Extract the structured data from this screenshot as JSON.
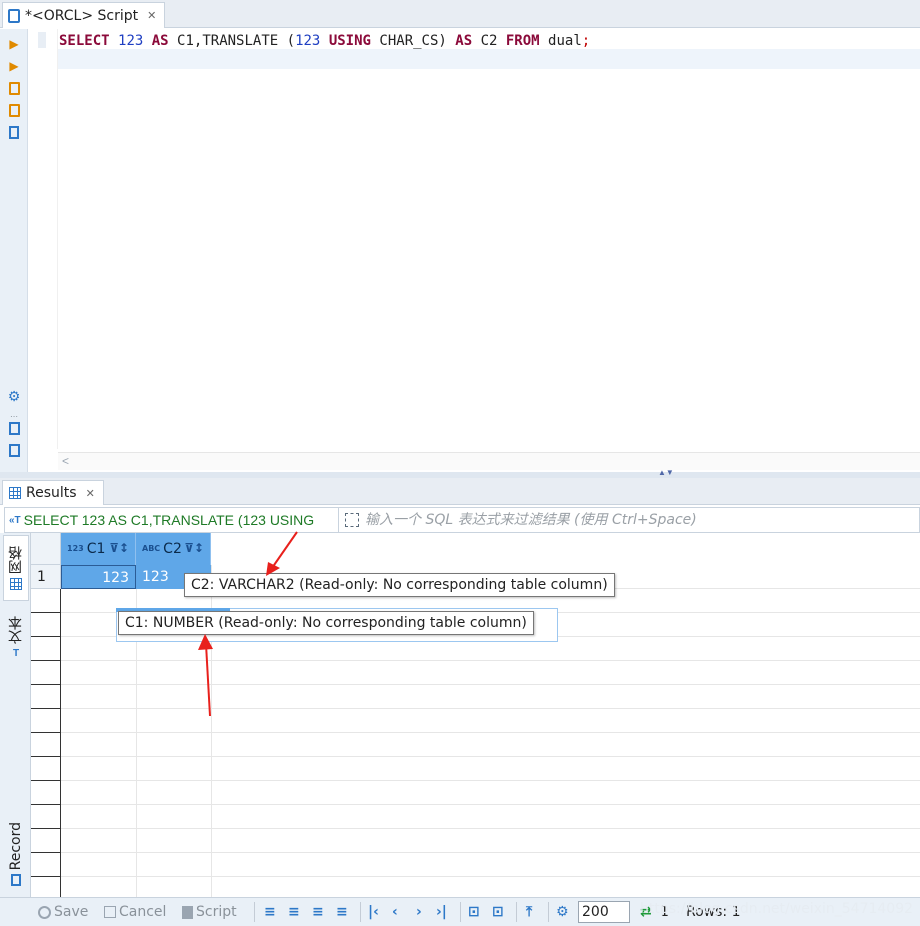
{
  "editor": {
    "tab_label": "*<ORCL> Script",
    "sql_tokens": {
      "select": "SELECT",
      "n1": "123",
      "as1": "AS",
      "c1": "C1,TRANSLATE",
      "paren": "(",
      "n2": "123",
      "using": "USING",
      "cs": "CHAR_CS)",
      "as2": "AS",
      "c2": "C2",
      "from": "FROM",
      "dual": "dual",
      "semi": ";"
    },
    "scroll_left": "<"
  },
  "results": {
    "tab_label": "Results",
    "query_echo": "SELECT 123 AS C1,TRANSLATE (123 USING",
    "filter_placeholder": "输入一个 SQL 表达式来过滤结果 (使用 Ctrl+Space)",
    "side_tabs": {
      "grid": "网格",
      "text": "文本",
      "record": "Record"
    },
    "columns": [
      {
        "name": "C1",
        "type_badge": "123"
      },
      {
        "name": "C2",
        "type_badge": "ABC"
      }
    ],
    "rows": [
      {
        "rownum": "1",
        "c1": "123",
        "c2": "123"
      }
    ],
    "tooltips": {
      "c2": "C2: VARCHAR2 (Read-only: No corresponding table column)",
      "c1": "C1: NUMBER (Read-only: No corresponding table column)"
    }
  },
  "toolbar": {
    "save": "Save",
    "cancel": "Cancel",
    "script": "Script",
    "fetch_size": "200",
    "count": "1",
    "rows": "Rows: 1"
  },
  "watermark": "https://blog.csdn.net/weixin_54714092",
  "colors": {
    "keyword": "#8b0a3a",
    "number": "#1f3fc2",
    "header_blue": "#5fa7e8",
    "query_green": "#1e7a26",
    "arrow_red": "#e8201c"
  }
}
